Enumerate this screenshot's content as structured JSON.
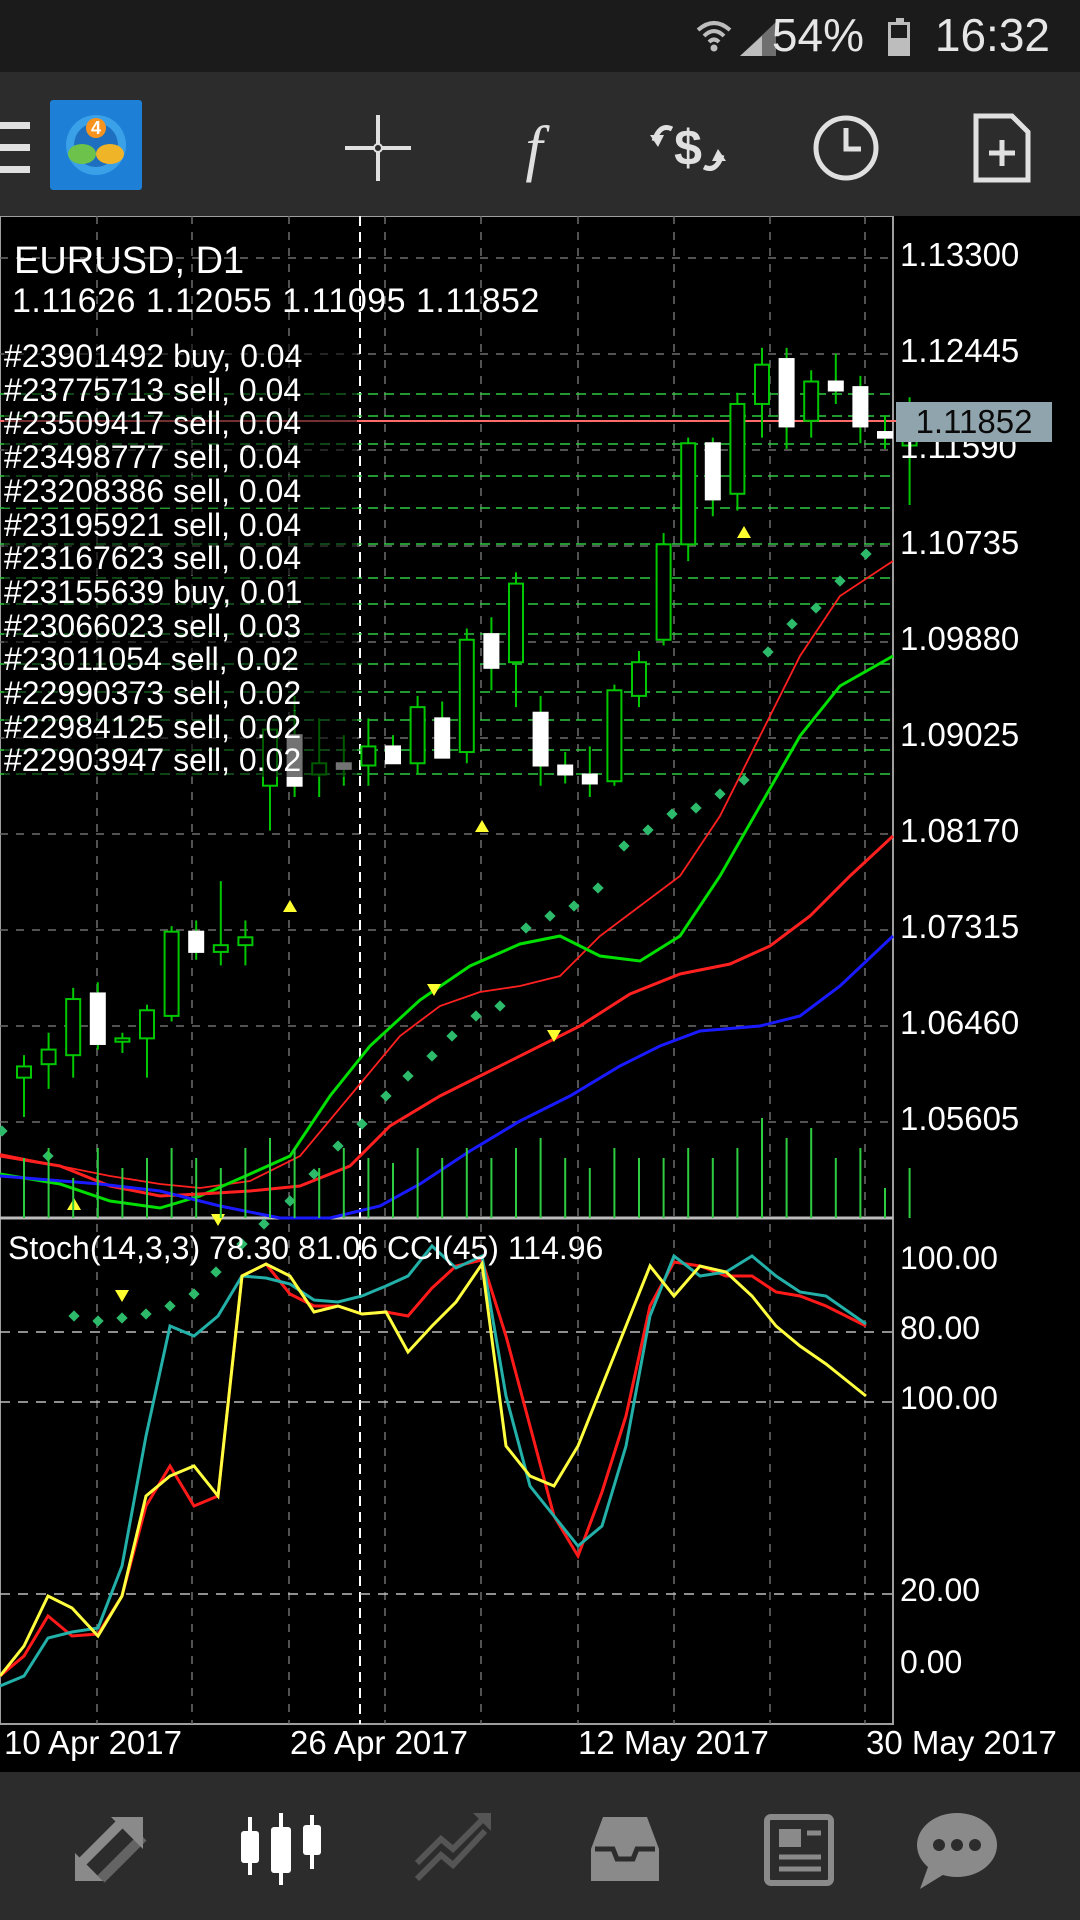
{
  "status_bar": {
    "battery": "54%",
    "time": "16:32"
  },
  "toolbar": {
    "icons": [
      "menu-icon",
      "metatrader-logo",
      "crosshair-icon",
      "indicators-icon",
      "trade-icon",
      "timeframe-icon",
      "template-icon"
    ]
  },
  "chart": {
    "symbol": "EURUSD, D1",
    "ohlc": "1.11626 1.12055 1.11095 1.11852",
    "current_price": "1.11852",
    "price_ticks": [
      "1.13300",
      "1.12445",
      "1.11590",
      "1.10735",
      "1.09880",
      "1.09025",
      "1.08170",
      "1.07315",
      "1.06460",
      "1.05605"
    ],
    "orders": [
      "#23901492 buy, 0.04",
      "#23775713 sell, 0.04",
      "#23509417 sell, 0.04",
      "#23498777 sell, 0.04",
      "#23208386 sell, 0.04",
      "#23195921 sell, 0.04",
      "#23167623 sell, 0.04",
      "#23155639 buy, 0.01",
      "#23066023 sell, 0.03",
      "#23011054 sell, 0.02",
      "#22990373 sell, 0.02",
      "#22984125 sell, 0.02",
      "#22903947 sell, 0.02"
    ],
    "oscillator_title": "Stoch(14,3,3) 78.30 81.06 CCI(45) 114.96",
    "oscillator_ticks": [
      "100.00",
      "80.00",
      "100.00",
      "20.00",
      "0.00"
    ],
    "dates": [
      "10 Apr 2017",
      "26 Apr 2017",
      "12 May 2017",
      "30 May 2017"
    ],
    "colors": {
      "bull": "#ffffff",
      "bear": "#00c800",
      "ma_fast": "#ff2020",
      "ma_mid": "#00e000",
      "ma_slow": "#1a1aff",
      "psar": "#2dbb6b",
      "stoch_main": "#ffff40",
      "stoch_signal": "#22b0a8",
      "cci": "#ff1a1a"
    }
  },
  "bottom_nav": {
    "items": [
      "quotes-icon",
      "chart-icon",
      "trade-icon",
      "history-icon",
      "news-icon",
      "chat-icon"
    ],
    "active": "chart-icon"
  }
}
